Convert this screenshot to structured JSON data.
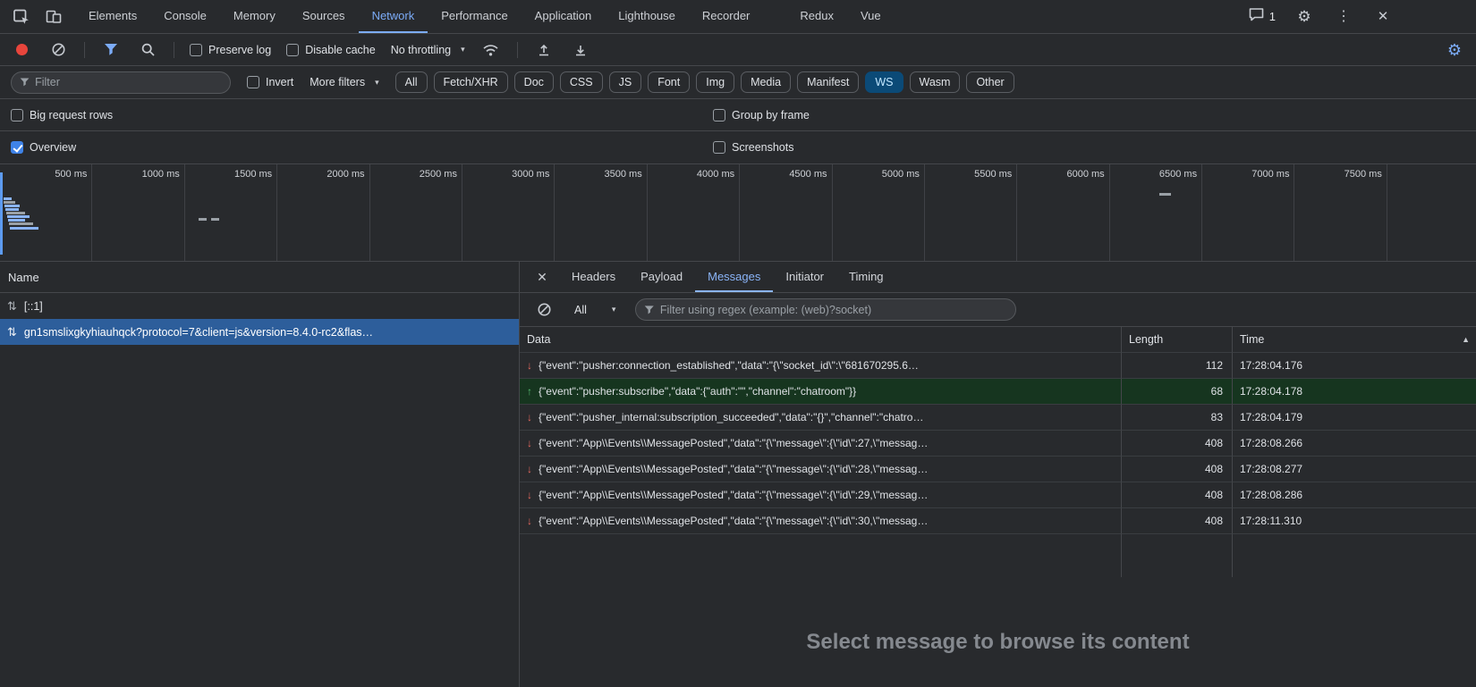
{
  "top_bar": {
    "tabs": [
      "Elements",
      "Console",
      "Memory",
      "Sources",
      "Network",
      "Performance",
      "Application",
      "Lighthouse",
      "Recorder",
      "Redux",
      "Vue"
    ],
    "active_tab": "Network",
    "extensions_start": "Redux",
    "chat_badge": "1"
  },
  "toolbar": {
    "preserve_log": "Preserve log",
    "disable_cache": "Disable cache",
    "throttling": "No throttling"
  },
  "filter_bar": {
    "placeholder": "Filter",
    "invert": "Invert",
    "more_filters": "More filters",
    "chips": [
      "All",
      "Fetch/XHR",
      "Doc",
      "CSS",
      "JS",
      "Font",
      "Img",
      "Media",
      "Manifest",
      "WS",
      "Wasm",
      "Other"
    ],
    "active_chip": "WS"
  },
  "options": {
    "big_request_rows": "Big request rows",
    "group_by_frame": "Group by frame",
    "overview": "Overview",
    "screenshots": "Screenshots"
  },
  "timeline": {
    "ticks": [
      "500 ms",
      "1000 ms",
      "1500 ms",
      "2000 ms",
      "2500 ms",
      "3000 ms",
      "3500 ms",
      "4000 ms",
      "4500 ms",
      "5000 ms",
      "5500 ms",
      "6000 ms",
      "6500 ms",
      "7000 ms",
      "7500 ms"
    ]
  },
  "requests": {
    "header": "Name",
    "rows": [
      {
        "label": "[::1]",
        "selected": false
      },
      {
        "label": "gn1smslixgkyhiauhqck?protocol=7&client=js&version=8.4.0-rc2&flas…",
        "selected": true
      }
    ]
  },
  "details": {
    "tabs": [
      "Headers",
      "Payload",
      "Messages",
      "Initiator",
      "Timing"
    ],
    "active_tab": "Messages",
    "filter": {
      "all_label": "All",
      "regex_placeholder": "Filter using regex (example: (web)?socket)"
    },
    "table": {
      "columns": [
        "Data",
        "Length",
        "Time"
      ],
      "rows": [
        {
          "dir": "receive",
          "data": "{\"event\":\"pusher:connection_established\",\"data\":\"{\\\"socket_id\\\":\\\"681670295.6…",
          "length": "112",
          "time": "17:28:04.176"
        },
        {
          "dir": "send",
          "data": "{\"event\":\"pusher:subscribe\",\"data\":{\"auth\":\"\",\"channel\":\"chatroom\"}}",
          "length": "68",
          "time": "17:28:04.178"
        },
        {
          "dir": "receive",
          "data": "{\"event\":\"pusher_internal:subscription_succeeded\",\"data\":\"{}\",\"channel\":\"chatro…",
          "length": "83",
          "time": "17:28:04.179"
        },
        {
          "dir": "receive",
          "data": "{\"event\":\"App\\\\Events\\\\MessagePosted\",\"data\":\"{\\\"message\\\":{\\\"id\\\":27,\\\"messag…",
          "length": "408",
          "time": "17:28:08.266"
        },
        {
          "dir": "receive",
          "data": "{\"event\":\"App\\\\Events\\\\MessagePosted\",\"data\":\"{\\\"message\\\":{\\\"id\\\":28,\\\"messag…",
          "length": "408",
          "time": "17:28:08.277"
        },
        {
          "dir": "receive",
          "data": "{\"event\":\"App\\\\Events\\\\MessagePosted\",\"data\":\"{\\\"message\\\":{\\\"id\\\":29,\\\"messag…",
          "length": "408",
          "time": "17:28:08.286"
        },
        {
          "dir": "receive",
          "data": "{\"event\":\"App\\\\Events\\\\MessagePosted\",\"data\":\"{\\\"message\\\":{\\\"id\\\":30,\\\"messag…",
          "length": "408",
          "time": "17:28:11.310"
        }
      ]
    },
    "empty_prompt": "Select message to browse its content"
  },
  "colors": {
    "accent_blue": "#7cacf8",
    "selected_row_blue": "#2d5e9b",
    "sent_row_green": "#16351f",
    "sent_arrow_green": "#57bb72",
    "received_arrow_red": "#e8695f",
    "record_red": "#e8453c",
    "chip_selected_bg": "#0b4a77"
  }
}
